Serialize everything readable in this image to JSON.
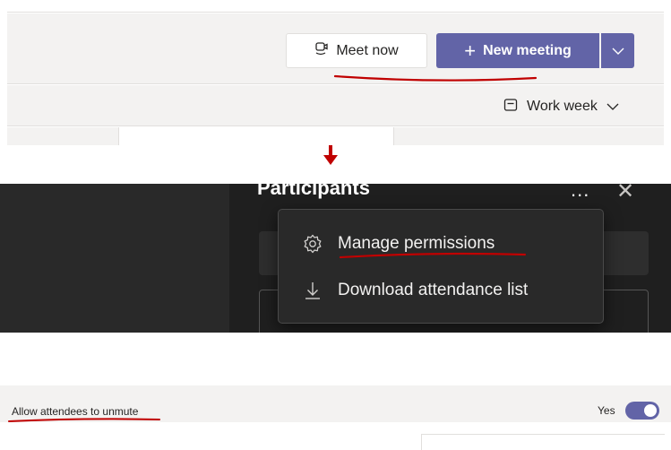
{
  "calendar": {
    "meet_now_label": "Meet now",
    "new_meeting_label": "New meeting",
    "view_label": "Work week"
  },
  "participants": {
    "title": "Participants",
    "more_label": "...",
    "menu": [
      {
        "label": "Manage permissions",
        "icon": "gear-icon"
      },
      {
        "label": "Download attendance list",
        "icon": "download-icon"
      }
    ]
  },
  "permissions": {
    "setting_label": "Allow attendees to unmute",
    "value_label": "Yes",
    "toggle_on": true
  },
  "colors": {
    "teams_purple": "#6264a7",
    "annotation_red": "#c00000",
    "dark_bg": "#292929"
  }
}
